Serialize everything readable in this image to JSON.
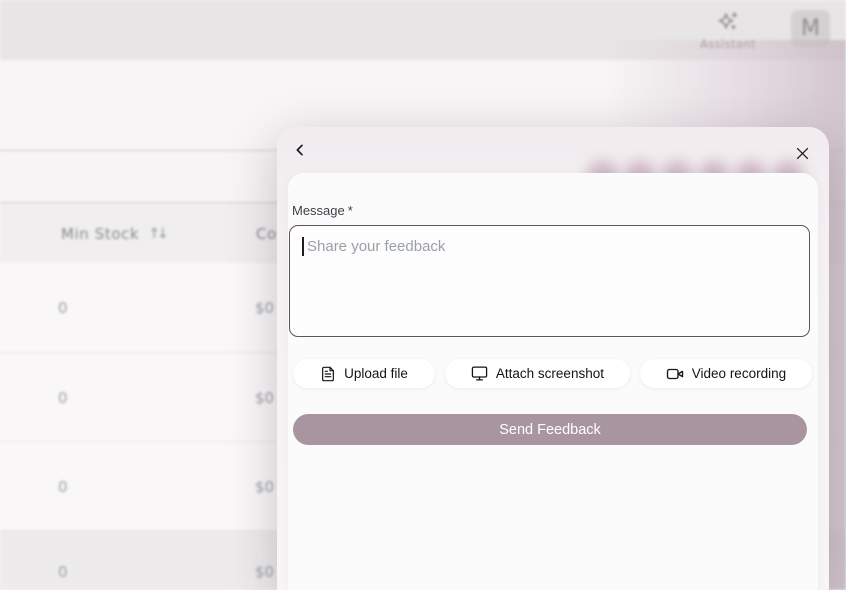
{
  "topbar": {
    "assistant_label": "Assistant",
    "avatar_initial": "M"
  },
  "table": {
    "headers": {
      "min_stock": "Min Stock",
      "cost_partial": "Co"
    },
    "sort_icon_glyph": "↑↓",
    "rows": [
      {
        "min_stock": "0",
        "cost": "$0"
      },
      {
        "min_stock": "0",
        "cost": "$0"
      },
      {
        "min_stock": "0",
        "cost": "$0"
      },
      {
        "min_stock": "0",
        "cost": "$0"
      }
    ]
  },
  "feedback_modal": {
    "message_label": "Message",
    "required_marker": "*",
    "message_placeholder": "Share your feedback",
    "actions": [
      {
        "label": "Upload file",
        "icon": "file-text-icon"
      },
      {
        "label": "Attach screenshot",
        "icon": "monitor-icon"
      },
      {
        "label": "Video recording",
        "icon": "video-camera-icon"
      }
    ],
    "submit_label": "Send Feedback",
    "rating_dot_count": 6,
    "colors": {
      "submit_bg": "#a9959f",
      "textarea_border": "#63505f",
      "rating_dot": "#c5a9b8",
      "right_glow": "#c7b6c0"
    }
  }
}
